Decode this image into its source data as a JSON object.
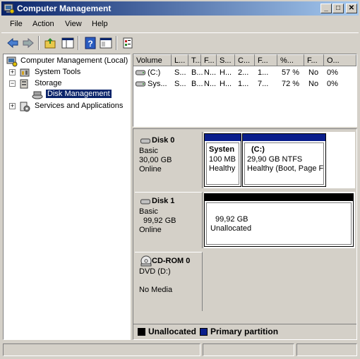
{
  "window": {
    "title": "Computer Management"
  },
  "menu": [
    "File",
    "Action",
    "View",
    "Help"
  ],
  "toolbar": {
    "buttons": [
      "back-arrow-icon",
      "forward-arrow-icon",
      "up-folder-icon",
      "show-hide-tree-icon",
      "help-icon",
      "console-view-icon",
      "properties-icon"
    ]
  },
  "tree": {
    "root": "Computer Management (Local)",
    "items": {
      "system_tools": "System Tools",
      "storage": "Storage",
      "disk_management": "Disk Management",
      "services": "Services and Applications"
    }
  },
  "volumes": {
    "columns": [
      "Volume",
      "L...",
      "T...",
      "F...",
      "S...",
      "C...",
      "F...",
      "%...",
      "F...",
      "O..."
    ],
    "rows": [
      [
        "(C:)",
        "S...",
        "B...",
        "N...",
        "H...",
        "2...",
        "1...",
        "57 %",
        "No",
        "0%"
      ],
      [
        "Sys...",
        "S...",
        "B...",
        "N...",
        "H...",
        "1...",
        "7...",
        "72 %",
        "No",
        "0%"
      ]
    ]
  },
  "disks": [
    {
      "name": "Disk 0",
      "type": "Basic",
      "size": "30,00 GB",
      "status": "Online",
      "partitions": [
        {
          "title": "Systen",
          "line2": "100 MB",
          "line3": "Healthy",
          "kind": "primary"
        },
        {
          "title": "(C:)",
          "line2": "29,90 GB NTFS",
          "line3": "Healthy (Boot, Page F",
          "kind": "primary"
        }
      ]
    },
    {
      "name": "Disk 1",
      "type": "Basic",
      "size": "99,92 GB",
      "status": "Online",
      "partitions": [
        {
          "title": "",
          "line2": "99,92 GB",
          "line3": "Unallocated",
          "kind": "unallocated"
        }
      ]
    },
    {
      "name": "CD-ROM 0",
      "type": "DVD (D:)",
      "size": "",
      "status": "No Media",
      "partitions": []
    }
  ],
  "legend": {
    "unallocated": "Unallocated",
    "primary": "Primary partition"
  },
  "colors": {
    "primary": "#0a1e8c",
    "unallocated": "#000000",
    "selection": "#0a246a"
  }
}
